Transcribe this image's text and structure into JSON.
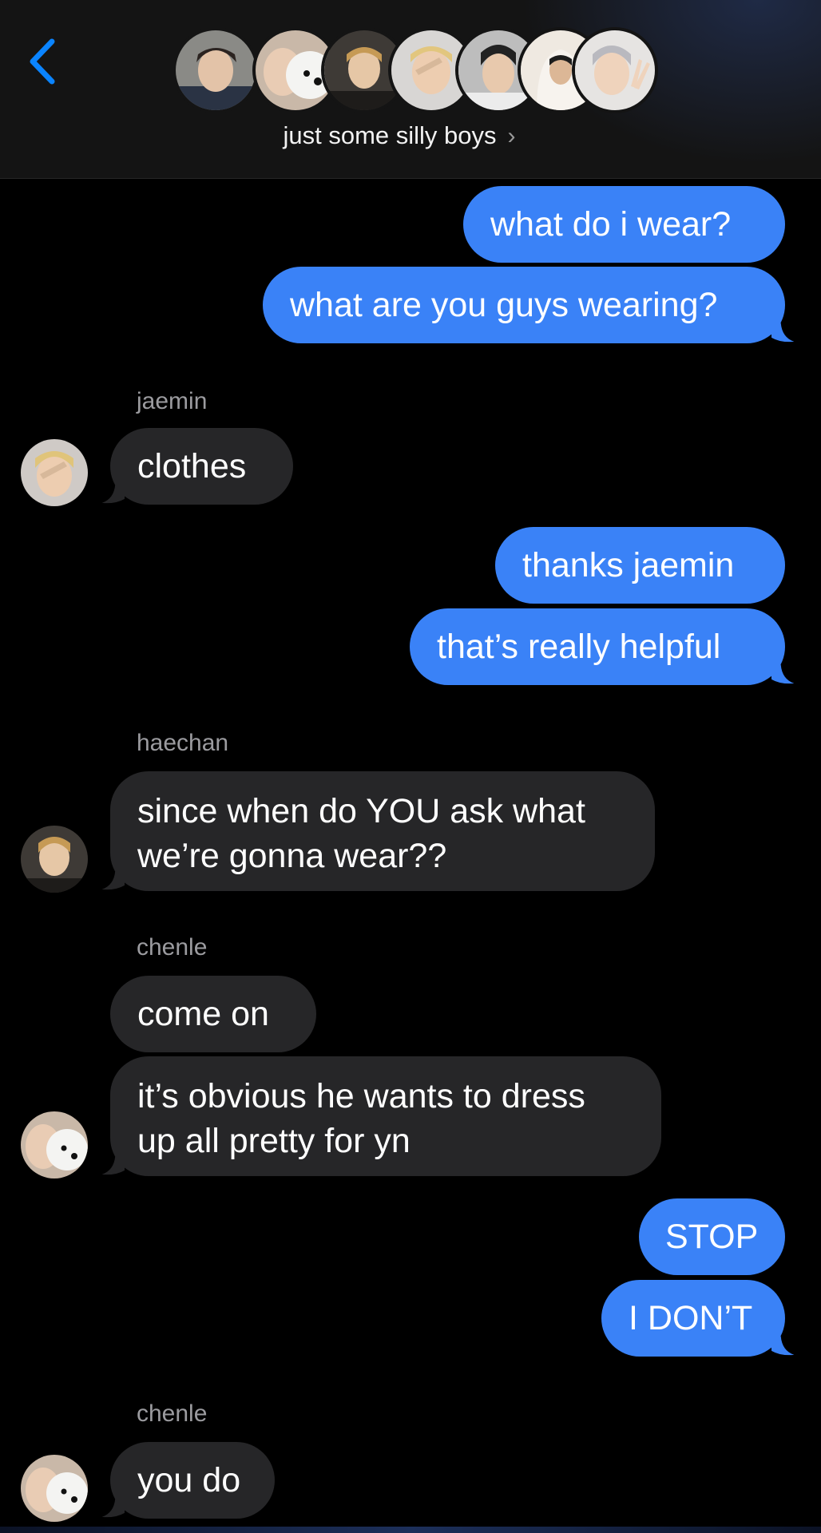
{
  "header": {
    "group_name": "just some silly boys",
    "chevron": "›",
    "back_icon": "chevron-left-icon",
    "accent": "#0a84ff",
    "members": [
      "member-1",
      "member-2",
      "member-3",
      "member-4",
      "member-5",
      "member-6",
      "member-7"
    ]
  },
  "messages": [
    {
      "id": "m1",
      "direction": "outgoing",
      "text": "what do i wear?"
    },
    {
      "id": "m2",
      "direction": "outgoing",
      "text": "what are you guys wearing?"
    },
    {
      "id": "m3",
      "direction": "incoming",
      "sender": "jaemin",
      "text": "clothes"
    },
    {
      "id": "m4",
      "direction": "outgoing",
      "text": "thanks jaemin"
    },
    {
      "id": "m5",
      "direction": "outgoing",
      "text": "that’s really helpful"
    },
    {
      "id": "m6",
      "direction": "incoming",
      "sender": "haechan",
      "lines": [
        "since when do YOU ask what",
        "we’re gonna wear??"
      ]
    },
    {
      "id": "m7",
      "direction": "incoming",
      "sender": "chenle",
      "text": "come on"
    },
    {
      "id": "m8",
      "direction": "incoming",
      "lines": [
        "it’s obvious he wants to dress",
        "up all pretty for yn"
      ]
    },
    {
      "id": "m9",
      "direction": "outgoing",
      "text": "STOP"
    },
    {
      "id": "m10",
      "direction": "outgoing",
      "text": "I DON’T"
    },
    {
      "id": "m11",
      "direction": "incoming",
      "sender": "chenle",
      "text": "you do"
    }
  ],
  "colors": {
    "outgoing_bubble": "#3a82f7",
    "incoming_bubble": "#262628",
    "background": "#000000"
  }
}
